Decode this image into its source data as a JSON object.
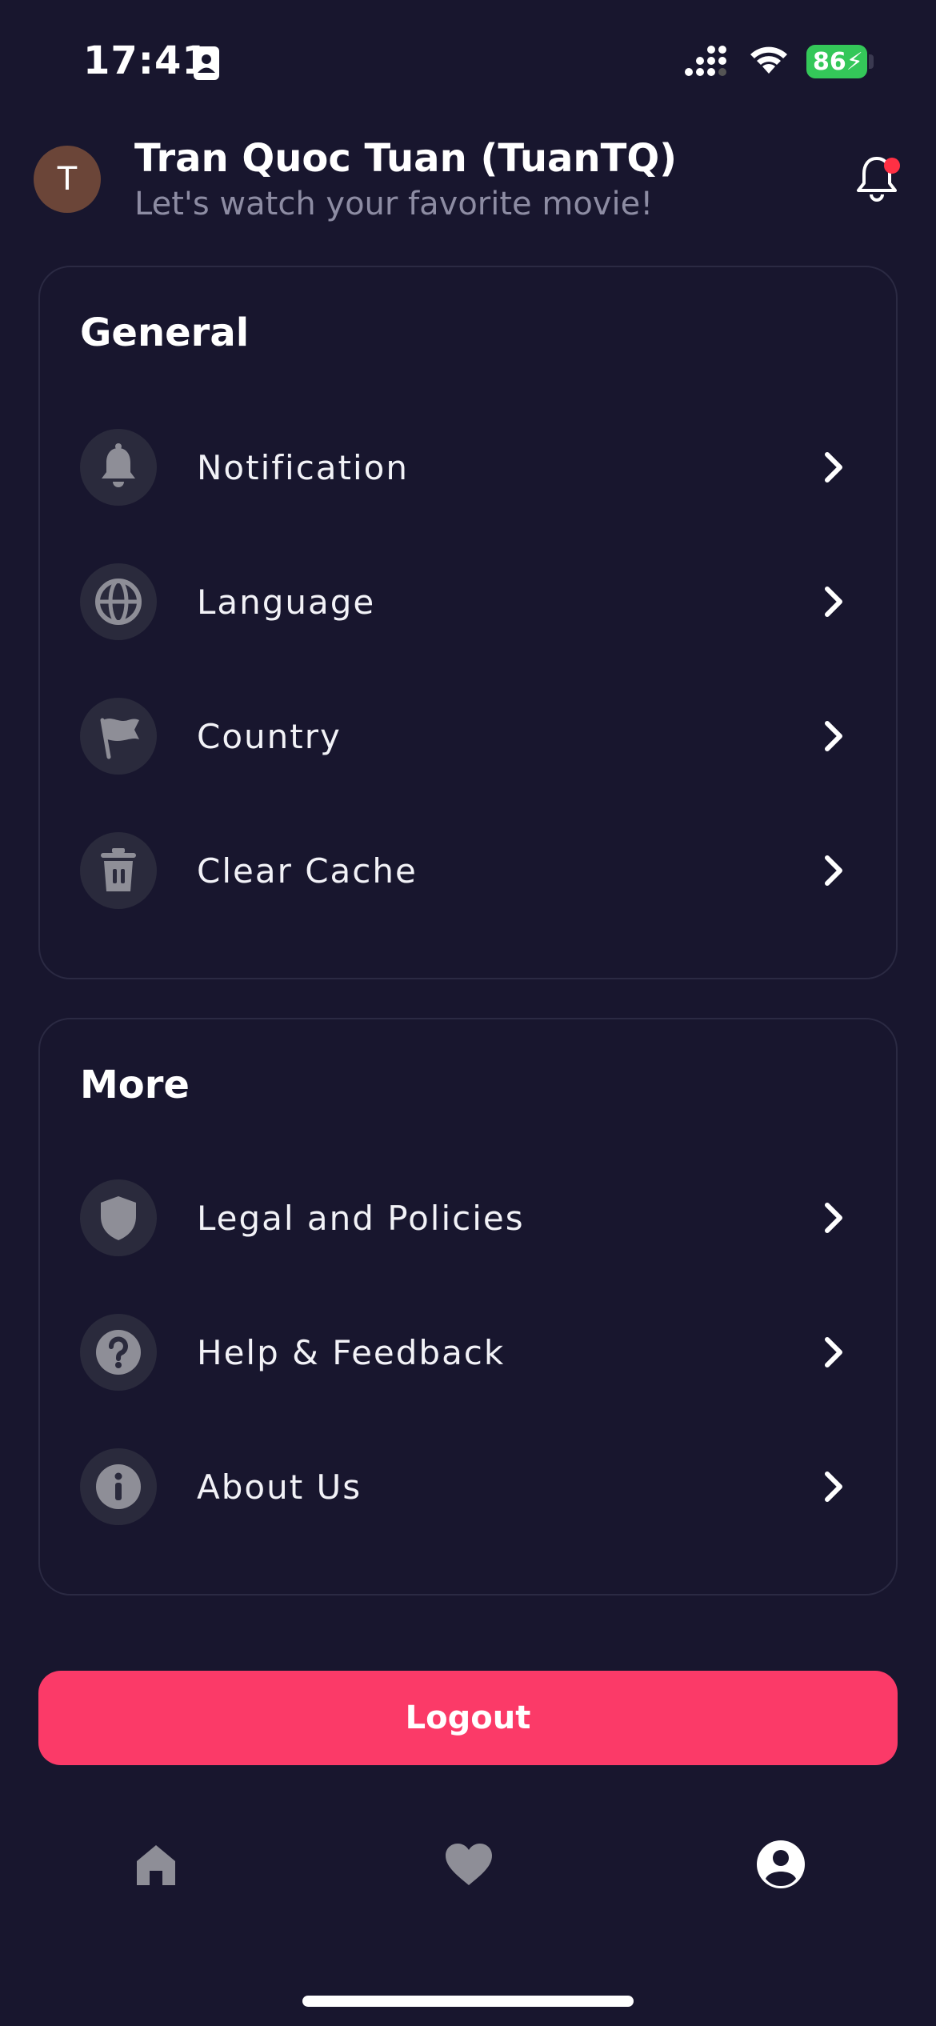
{
  "status_bar": {
    "time": "17:41",
    "battery": "86"
  },
  "header": {
    "avatar_initial": "T",
    "user_name": "Tran Quoc Tuan (TuanTQ)",
    "subtitle": "Let's watch your favorite movie!"
  },
  "general": {
    "title": "General",
    "items": [
      {
        "label": "Notification",
        "icon": "bell-icon"
      },
      {
        "label": "Language",
        "icon": "globe-icon"
      },
      {
        "label": "Country",
        "icon": "flag-icon"
      },
      {
        "label": "Clear Cache",
        "icon": "trash-icon"
      }
    ]
  },
  "more": {
    "title": "More",
    "items": [
      {
        "label": "Legal and Policies",
        "icon": "shield-icon"
      },
      {
        "label": "Help & Feedback",
        "icon": "help-icon"
      },
      {
        "label": "About Us",
        "icon": "info-icon"
      }
    ]
  },
  "logout": {
    "label": "Logout"
  },
  "tab_bar": {
    "items": [
      "home-icon",
      "heart-icon",
      "profile-icon"
    ],
    "active": "profile-icon"
  },
  "colors": {
    "background": "#18162e",
    "accent": "#fb3a68",
    "icon_bg": "#2a2a3c",
    "muted_text": "#8d8ca3"
  }
}
